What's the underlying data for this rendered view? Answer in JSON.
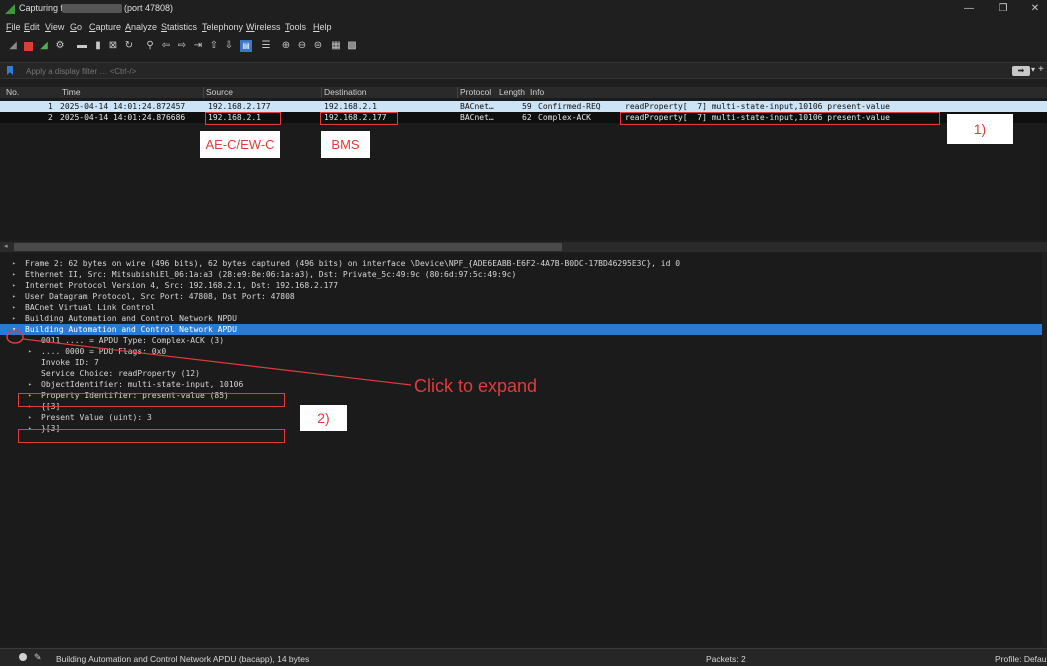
{
  "window": {
    "title_prefix": "Capturing from 1",
    "title_port": "(port 47808)",
    "controls": [
      "—",
      "❐",
      "✕"
    ]
  },
  "menu": [
    "File",
    "Edit",
    "View",
    "Go",
    "Capture",
    "Analyze",
    "Statistics",
    "Telephony",
    "Wireless",
    "Tools",
    "Help"
  ],
  "filter": {
    "placeholder": "Apply a display filter … <Ctrl-/>",
    "apply_glyph": "➡",
    "dropdown_glyph": "▾",
    "add_glyph": "+"
  },
  "packet_list": {
    "columns": [
      "No.",
      "Time",
      "Source",
      "Destination",
      "Protocol",
      "Length",
      "Info"
    ],
    "rows": [
      {
        "no": "1",
        "time": "2025-04-14 14:01:24.872457",
        "source": "192.168.2.177",
        "destination": "192.168.2.1",
        "protocol": "BACnet…",
        "length": "59",
        "info_type": "Confirmed-REQ",
        "info": "readProperty[  7] multi-state-input,10106 present-value"
      },
      {
        "no": "2",
        "time": "2025-04-14 14:01:24.876686",
        "source": "192.168.2.1",
        "destination": "192.168.2.177",
        "protocol": "BACnet…",
        "length": "62",
        "info_type": "Complex-ACK",
        "info": "readProperty[  7] multi-state-input,10106 present-value"
      }
    ]
  },
  "details": [
    {
      "text": "Frame 2: 62 bytes on wire (496 bits), 62 bytes captured (496 bits) on interface \\Device\\NPF_{ADE6EABB-E6F2-4A7B-B0DC-17BD46295E3C}, id 0",
      "indent": 0,
      "tri": "▸"
    },
    {
      "text": "Ethernet II, Src: MitsubishiEl_06:1a:a3 (28:e9:8e:06:1a:a3), Dst: Private_5c:49:9c (80:6d:97:5c:49:9c)",
      "indent": 0,
      "tri": "▸"
    },
    {
      "text": "Internet Protocol Version 4, Src: 192.168.2.1, Dst: 192.168.2.177",
      "indent": 0,
      "tri": "▸"
    },
    {
      "text": "User Datagram Protocol, Src Port: 47808, Dst Port: 47808",
      "indent": 0,
      "tri": "▸"
    },
    {
      "text": "BACnet Virtual Link Control",
      "indent": 0,
      "tri": "▸"
    },
    {
      "text": "Building Automation and Control Network NPDU",
      "indent": 0,
      "tri": "▸"
    },
    {
      "text": "Building Automation and Control Network APDU",
      "indent": 0,
      "tri": "▾",
      "highlight": true
    },
    {
      "text": "0011 .... = APDU Type: Complex-ACK (3)",
      "indent": 2,
      "tri": ""
    },
    {
      "text": ".... 0000 = PDU Flags: 0x0",
      "indent": 1,
      "tri": "▸"
    },
    {
      "text": "Invoke ID: 7",
      "indent": 2,
      "tri": ""
    },
    {
      "text": "Service Choice: readProperty (12)",
      "indent": 2,
      "tri": ""
    },
    {
      "text": "ObjectIdentifier: multi-state-input, 10106",
      "indent": 1,
      "tri": "▸"
    },
    {
      "text": "Property Identifier: present-value (85)",
      "indent": 1,
      "tri": "▸"
    },
    {
      "text": "{[3]",
      "indent": 1,
      "tri": "▸"
    },
    {
      "text": "Present Value (uint): 3",
      "indent": 1,
      "tri": "▸"
    },
    {
      "text": "}[3]",
      "indent": 1,
      "tri": "▸"
    }
  ],
  "status": {
    "field_text": "Building Automation and Control Network APDU (bacapp), 14 bytes",
    "packets": "Packets: 2",
    "profile": "Profile: Defau"
  },
  "annotations": {
    "source_label": "AE-C/EW-C",
    "destination_label": "BMS",
    "label_1": "1)",
    "label_2": "2)",
    "click_text": "Click to expand",
    "color": "#e23b3b"
  },
  "colors": {
    "selected_row": "#cde4f6",
    "details_highlight": "#2a7ad1",
    "filter_bookmark": "#2f7fd6"
  }
}
